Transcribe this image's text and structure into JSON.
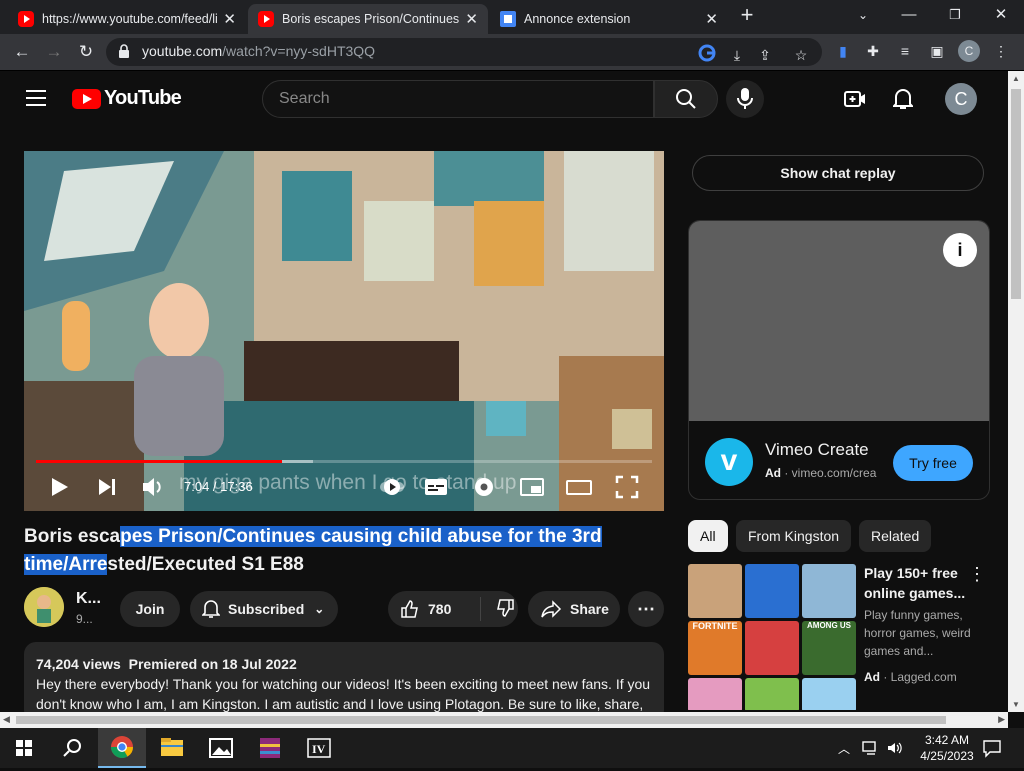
{
  "browser": {
    "tabs": [
      {
        "title": "https://www.youtube.com/feed/li",
        "active": false
      },
      {
        "title": "Boris escapes Prison/Continues c",
        "active": true
      },
      {
        "title": "Annonce extension",
        "active": false
      }
    ],
    "url_host": "youtube.com",
    "url_path": "/watch?v=nyy-sdHT3QQ",
    "profile_initial": "C"
  },
  "header": {
    "logo_text": "YouTube",
    "search_placeholder": "Search",
    "avatar_initial": "C"
  },
  "player": {
    "current_time": "7:04",
    "duration": "17:36",
    "progress_fraction": 0.4,
    "buffer_fraction": 0.45,
    "caption": "my giga pants when I go to stand up"
  },
  "video": {
    "title_plain_start": "Boris esca",
    "title_highlighted": "pes Prison/Continues causing child abuse for the 3rd time/Arre",
    "title_plain_end": "sted/Executed S1 E88",
    "channel_name": "K...",
    "channel_subs": "9...",
    "join_label": "Join",
    "subscribed_label": "Subscribed",
    "likes": "780",
    "share_label": "Share",
    "views": "74,204 views",
    "premiered": "Premiered on 18 Jul 2022",
    "description": "Hey there everybody! Thank you for watching our videos! It's been exciting to meet new fans. If you don't know who I am, I am Kingston. I am autistic and I love using Plotagon. Be sure to like, share,"
  },
  "sidebar": {
    "chat_replay_label": "Show chat replay",
    "ad1": {
      "title": "Vimeo Create",
      "ad_label": "Ad",
      "domain": "vimeo.com/crea",
      "cta": "Try free"
    },
    "chips": [
      "All",
      "From Kingston",
      "Related"
    ],
    "ad2": {
      "title": "Play 150+ free online games...",
      "description": "Play funny games, horror games, weird games and...",
      "ad_label": "Ad",
      "domain": "Lagged.com"
    },
    "game_tiles": [
      "FORTNITE",
      "AMONG US"
    ]
  },
  "taskbar": {
    "time": "3:42 AM",
    "date": "4/25/2023"
  },
  "colors": {
    "yt_red": "#ff0000",
    "highlight": "#1a61c9",
    "cta_blue": "#3ea6ff",
    "vimeo_blue": "#1ab7ea"
  }
}
